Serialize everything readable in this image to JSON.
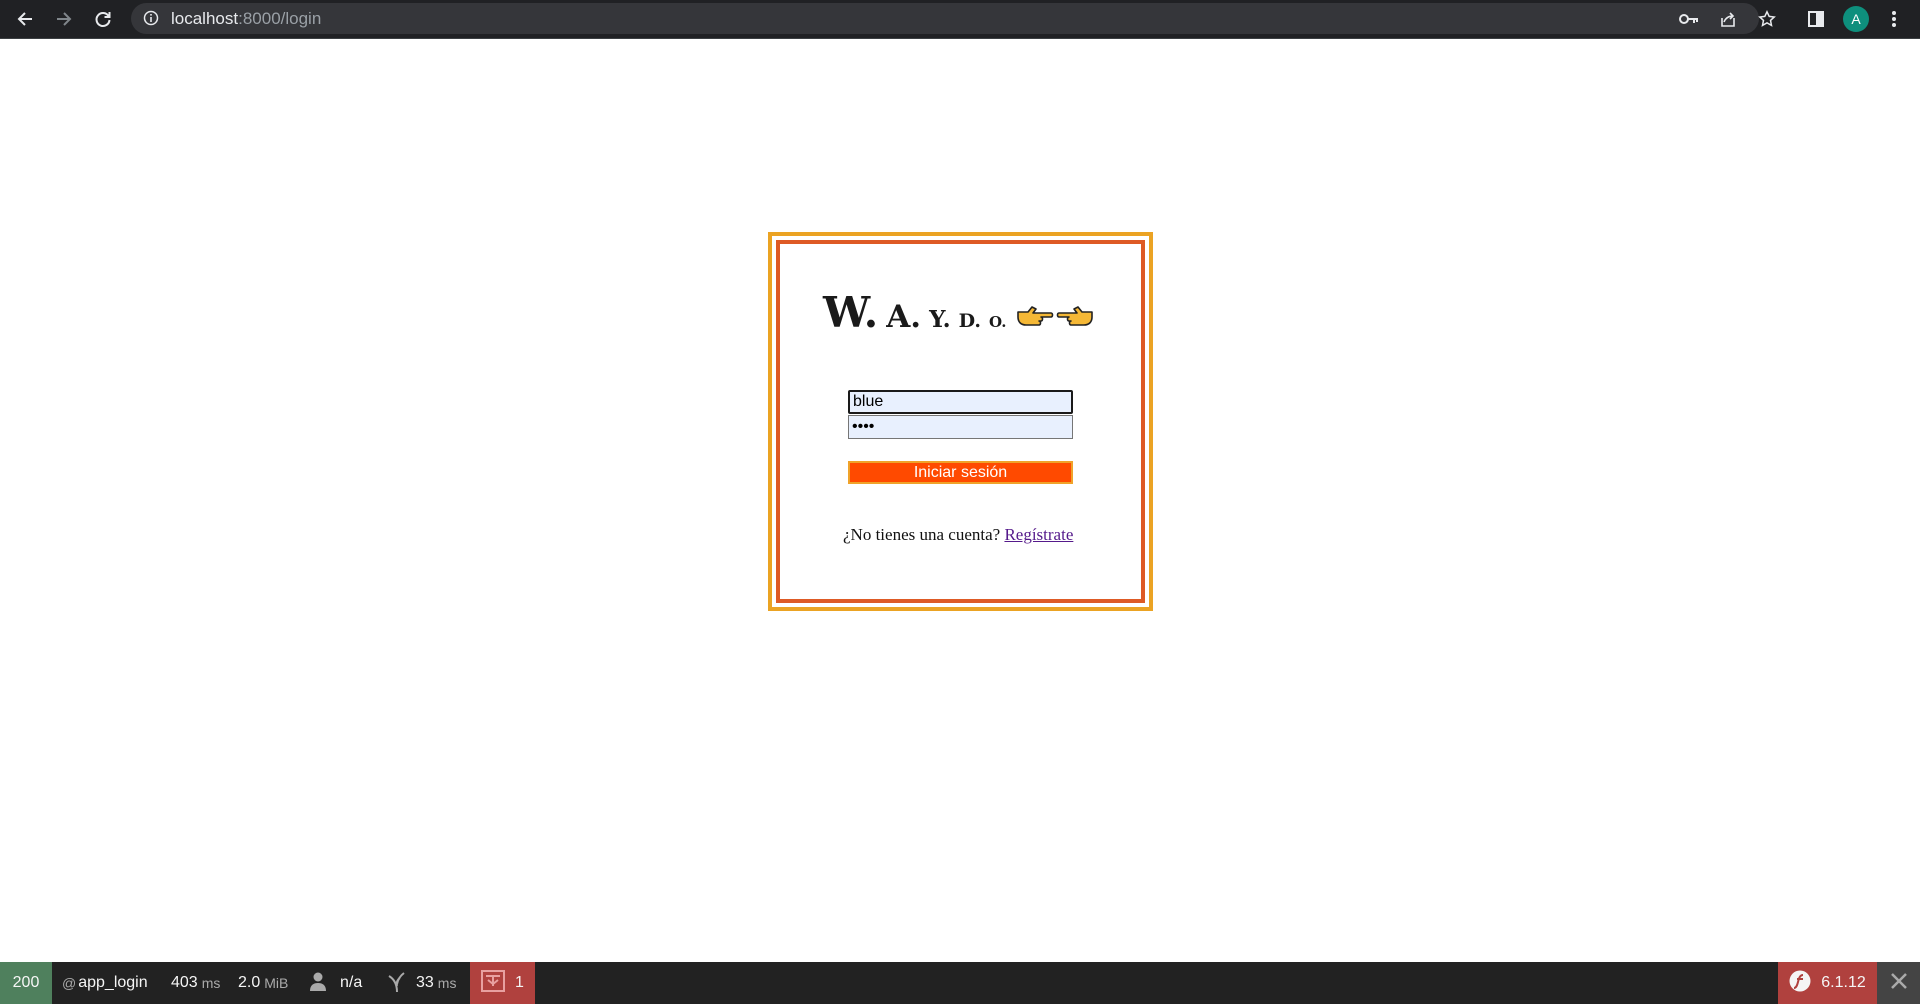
{
  "browser": {
    "url_host": "localhost",
    "url_rest": ":8000/login",
    "profile_initial": "A",
    "icons": [
      "back-arrow-icon",
      "forward-arrow-icon",
      "reload-icon",
      "info-icon",
      "key-icon",
      "share-icon",
      "star-icon",
      "side-panel-icon",
      "kebab-menu-icon"
    ]
  },
  "login": {
    "logo_letters": [
      "W.",
      "A.",
      "Y.",
      "D.",
      "O."
    ],
    "logo_emoji": [
      "pointing-right-hand-icon",
      "pointing-left-hand-icon"
    ],
    "username_value": "blue",
    "password_value": "abcd",
    "submit_label": "Iniciar sesión",
    "signup_prompt": "¿No tienes una cuenta?",
    "signup_link": "Regístrate",
    "colors": {
      "outer_border": "#eba323",
      "inner_border": "#de5a25",
      "button_bg": "#ff4a00"
    }
  },
  "toolbar": {
    "status_code": "200",
    "route_prefix": "@",
    "route": "app_login",
    "time_value": "403",
    "time_unit": "ms",
    "memory_value": "2.0",
    "memory_unit": "MiB",
    "user": "n/a",
    "twig_value": "33",
    "twig_unit": "ms",
    "errors_count": "1",
    "symfony_version": "6.1.12"
  }
}
